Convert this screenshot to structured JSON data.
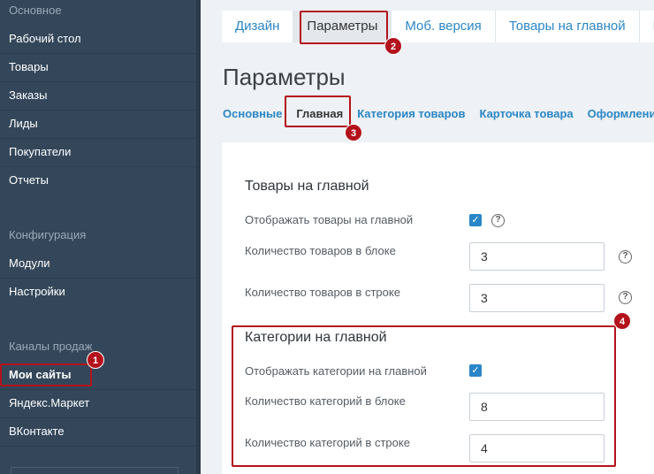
{
  "sidebar": {
    "group_main": "Основное",
    "group_config": "Конфигурация",
    "group_channels": "Каналы продаж",
    "items_main": [
      "Рабочий стол",
      "Товары",
      "Заказы",
      "Лиды",
      "Покупатели",
      "Отчеты"
    ],
    "items_config": [
      "Модули",
      "Настройки"
    ],
    "items_channels": [
      "Мои сайты",
      "Яндекс.Маркет",
      "ВКонтакте"
    ]
  },
  "top_tabs": [
    "Дизайн",
    "Параметры",
    "Моб. версия",
    "Товары на главной",
    "М"
  ],
  "page_title": "Параметры",
  "sub_tabs": [
    "Основные",
    "Главная",
    "Категория товаров",
    "Карточка товара",
    "Оформлени"
  ],
  "section_products": {
    "title": "Товары на главной",
    "show_label": "Отображать товары на главной",
    "show_checked": true,
    "count_block_label": "Количество товаров в блоке",
    "count_block_value": "3",
    "count_row_label": "Количество товаров в строке",
    "count_row_value": "3"
  },
  "section_categories": {
    "title": "Категории на главной",
    "show_label": "Отображать категории на главной",
    "show_checked": true,
    "count_block_label": "Количество категорий в блоке",
    "count_block_value": "8",
    "count_row_label": "Количество категорий в строке",
    "count_row_value": "4"
  },
  "icons": {
    "check": "checkmark-icon",
    "help": "question-icon"
  },
  "badges": [
    "1",
    "2",
    "3",
    "4"
  ],
  "colors": {
    "sidebar": "#34475a",
    "link": "#2a86c7",
    "highlight": "#b3121c",
    "checkbox": "#2a86c7"
  }
}
